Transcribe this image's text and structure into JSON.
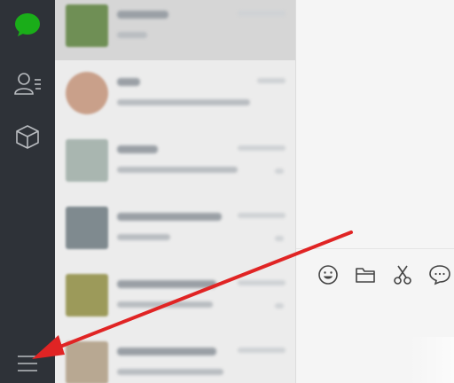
{
  "app": {
    "sidebar": {
      "items": [
        {
          "icon": "chat-bubble-icon",
          "state": "active",
          "color": "#1aad19"
        },
        {
          "icon": "contacts-icon",
          "state": "inactive"
        },
        {
          "icon": "favorites-cube-icon",
          "state": "inactive"
        },
        {
          "icon": "menu-hamburger-icon",
          "state": "inactive"
        }
      ]
    },
    "chat_list": {
      "items": [
        {
          "avatar_color": "#6f8f55",
          "selected": true
        },
        {
          "avatar_color": "#c9a08a",
          "selected": false
        },
        {
          "avatar_color": "#a9b6b0",
          "selected": false
        },
        {
          "avatar_color": "#7f8a8f",
          "selected": false
        },
        {
          "avatar_color": "#9c9a5a",
          "selected": false
        },
        {
          "avatar_color": "#b8a892",
          "selected": false
        }
      ]
    },
    "toolbar": {
      "tools": [
        "emoji-icon",
        "folder-icon",
        "scissors-icon",
        "chat-history-icon"
      ]
    },
    "annotation": {
      "arrow_color": "#e02424"
    }
  }
}
